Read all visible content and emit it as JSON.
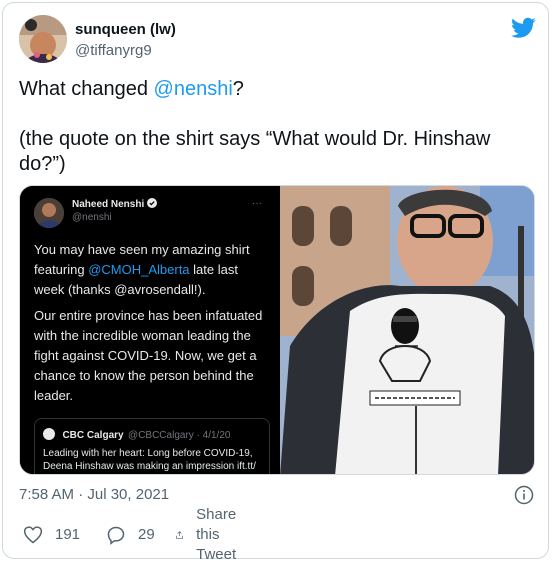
{
  "author": {
    "display_name": "sunqueen (lw)",
    "handle": "@tiffanyrg9"
  },
  "tweet": {
    "text_before": "What changed ",
    "mention": "@nenshi",
    "text_after": "?",
    "quote_line1": "(the quote on the shirt says “What would Dr. Hinshaw",
    "quote_line2": "do?”)"
  },
  "media": {
    "left_screenshot": {
      "name": "Naheed Nenshi",
      "handle": "@nenshi",
      "dots": "···",
      "p1_before": "You may have seen my amazing shirt featuring ",
      "p1_mention": "@CMOH_Alberta",
      "p1_after": " late last week (thanks @avrosendall!).",
      "p2": "Our entire province has been infatuated with the incredible woman leading the fight against COVID-19. Now, we get a chance to know the person behind the leader.",
      "quoted_name": "CBC Calgary",
      "quoted_meta": "@CBCCalgary · 4/1/20",
      "quoted_text": "Leading with her heart: Long before COVID-19, Deena Hinshaw was making an impression ift.tt/"
    }
  },
  "timestamp": "7:58 AM · Jul 30, 2021",
  "actions": {
    "likes": "191",
    "replies": "29",
    "share_label": "Share this Tweet"
  },
  "colors": {
    "accent": "#1d9bf0",
    "text": "#0f1419",
    "muted": "#536471"
  },
  "icons": [
    "twitter-bird-icon",
    "info-icon",
    "heart-icon",
    "reply-icon",
    "share-icon",
    "verified-icon"
  ]
}
